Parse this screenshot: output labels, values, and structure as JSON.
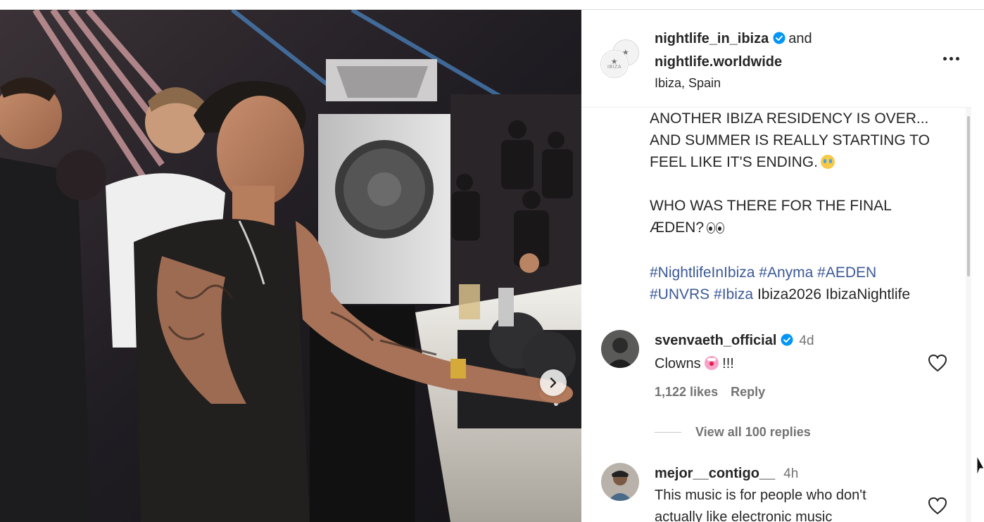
{
  "post": {
    "author_primary": "nightlife_in_ibiza",
    "author_joiner": "and",
    "author_secondary": "nightlife.worldwide",
    "location": "Ibiza, Spain",
    "avatar_logo_text": "IBIZA",
    "caption": {
      "line1": "ANOTHER IBIZA RESIDENCY IS OVER...",
      "line2": "AND SUMMER IS REALLY STARTING TO",
      "line3": "FEEL LIKE IT'S ENDING.",
      "line4": "WHO WAS THERE FOR THE FINAL",
      "line5": "ÆDEN?",
      "hashtags_line1": [
        "#NightlifeInIbiza",
        "#Anyma",
        "#AEDEN"
      ],
      "hashtags_line2": [
        "#UNVRS",
        "#Ibiza"
      ],
      "plain_tags": "Ibiza2026 IbizaNightlife"
    }
  },
  "comments": [
    {
      "username": "svenvaeth_official",
      "verified": true,
      "time": "4d",
      "text": "Clowns",
      "text_suffix": "!!!",
      "likes": "1,122 likes",
      "reply_label": "Reply",
      "view_replies": "View all 100 replies"
    },
    {
      "username": "mejor__contigo__",
      "verified": false,
      "time": "4h",
      "text_line1": "This music is for people who don't",
      "text_line2": "actually like electronic music"
    }
  ],
  "icons": {
    "verified": "verified-badge-icon",
    "more": "more-options-icon",
    "next": "chevron-right-icon",
    "like": "heart-outline-icon"
  },
  "colors": {
    "verified_blue": "#0095f6",
    "hashtag": "#3b5998",
    "secondary_text": "#737373"
  }
}
